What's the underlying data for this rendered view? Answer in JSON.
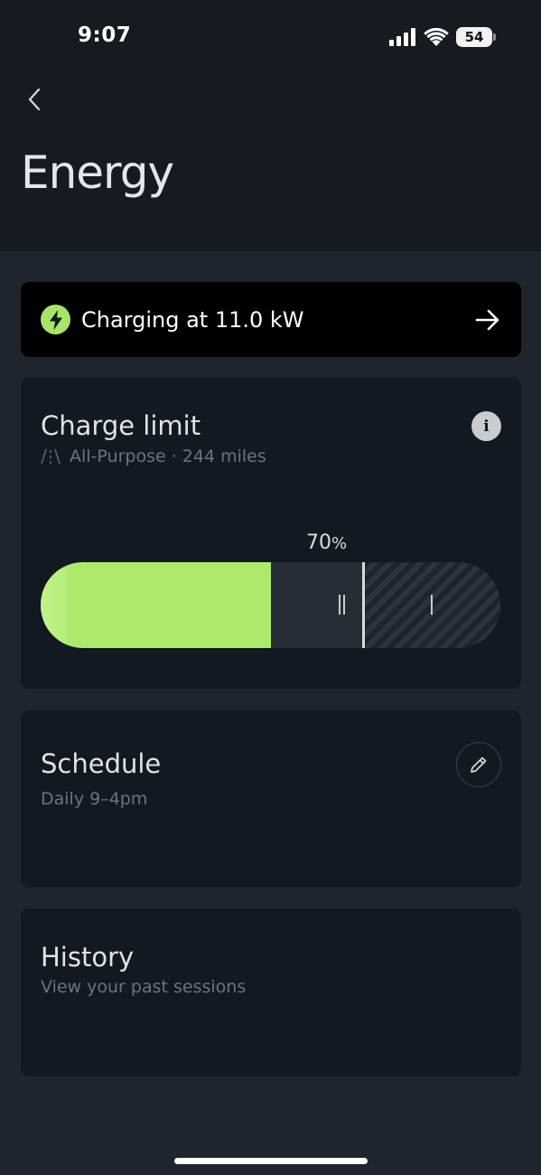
{
  "status_bar": {
    "time": "9:07",
    "battery_level": "54",
    "icons": [
      "cellular-signal-icon",
      "wifi-icon",
      "battery-icon"
    ]
  },
  "header": {
    "back_icon": "chevron-left-icon",
    "title": "Energy"
  },
  "charging_banner": {
    "icon": "lightning-bolt-icon",
    "text": "Charging at 11.0 kW",
    "action_icon": "arrow-right-icon"
  },
  "charge_limit": {
    "title": "Charge limit",
    "mode_icon": "road-icon",
    "subtitle": "All-Purpose · 244 miles",
    "limit_value": "70",
    "limit_unit": "%",
    "limit_percent": 70,
    "current_charge_percent": 50,
    "info_icon": "info-icon"
  },
  "schedule": {
    "title": "Schedule",
    "subtitle": "Daily 9–4pm",
    "edit_icon": "pencil-icon"
  },
  "history": {
    "title": "History",
    "subtitle": "View your past sessions"
  },
  "colors": {
    "accent": "#aee96c",
    "background": "#1e252d",
    "header": "#161b21",
    "card": "#131920",
    "banner": "#000000"
  }
}
